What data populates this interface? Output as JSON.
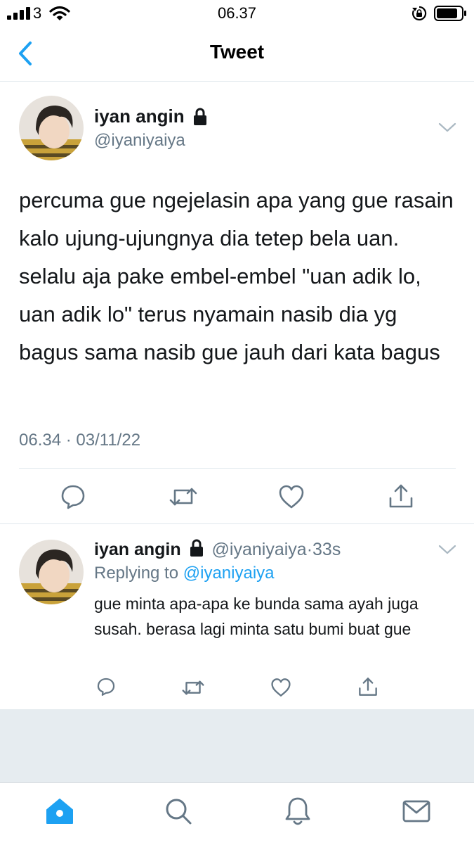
{
  "status_bar": {
    "carrier": "3",
    "time": "06.37"
  },
  "nav": {
    "title": "Tweet",
    "back_icon": "chevron-left-icon"
  },
  "tweet": {
    "name": "iyan angin",
    "handle": "@iyaniyaiya",
    "text": "percuma gue ngejelasin apa yang gue rasain kalo ujung-ujungnya dia tetep bela uan. selalu aja pake embel-embel \"uan adik lo, uan adik lo\" terus nyamain nasib dia yg bagus sama nasib gue jauh dari kata bagus",
    "time": "06.34",
    "separator": "·",
    "date": "03/11/22"
  },
  "reply": {
    "name": "iyan angin",
    "handle": "@iyaniyaiya",
    "separator": "·",
    "age": "33s",
    "replying_label": "Replying to",
    "replying_handle": "@iyaniyaiya",
    "text": "gue minta apa-apa ke bunda sama ayah juga susah. berasa lagi minta satu bumi buat gue"
  },
  "colors": {
    "accent": "#1da1f2",
    "muted": "#657786",
    "divider": "#e1e8ed",
    "background_gray": "#e6ecf0"
  },
  "tab_bar": {
    "items": [
      {
        "name": "home",
        "icon": "home-icon",
        "active": true
      },
      {
        "name": "search",
        "icon": "search-icon",
        "active": false
      },
      {
        "name": "notifications",
        "icon": "bell-icon",
        "active": false
      },
      {
        "name": "messages",
        "icon": "mail-icon",
        "active": false
      }
    ]
  }
}
